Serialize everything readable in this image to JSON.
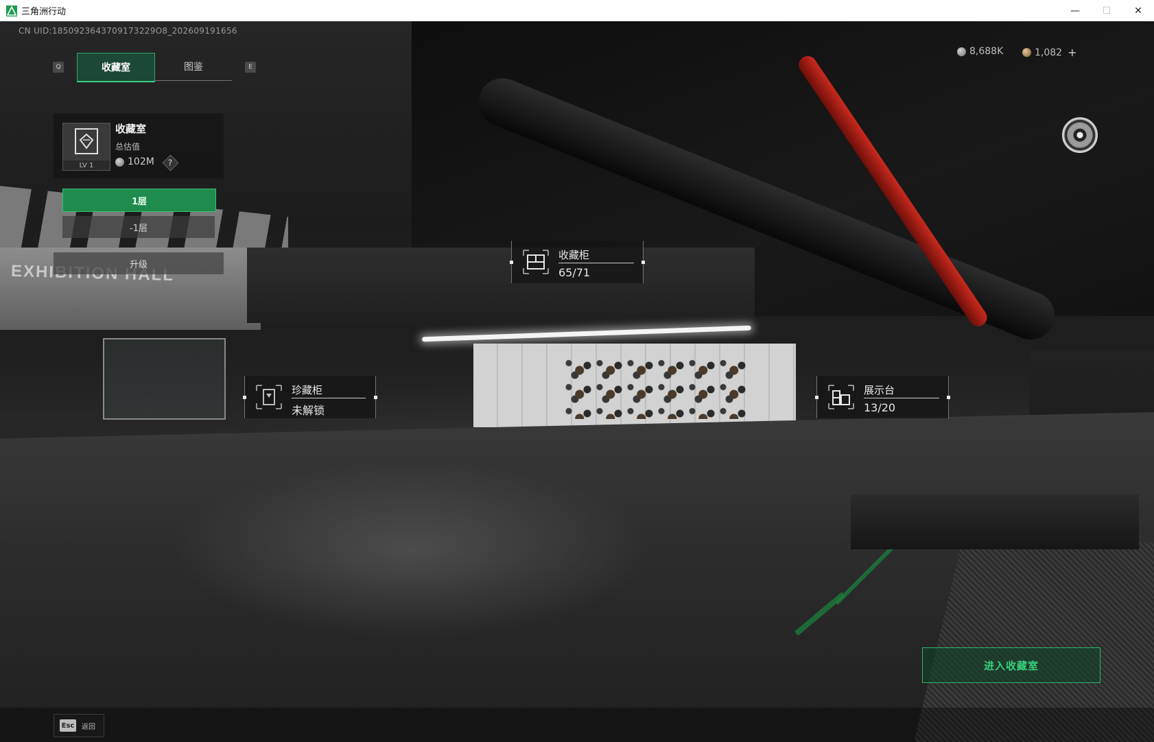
{
  "window": {
    "title": "三角洲行动",
    "minimize_glyph": "—",
    "maximize_glyph": "☐",
    "close_glyph": "✕"
  },
  "uid_text": "CN UID:1850923643709173229O8_202609191656",
  "tabs": {
    "prev_key": "Q",
    "next_key": "E",
    "items": [
      {
        "label": "收藏室",
        "active": true
      },
      {
        "label": "图鉴",
        "active": false
      }
    ]
  },
  "room_panel": {
    "title": "收藏室",
    "level": "LV 1",
    "value_label": "总估值",
    "value": "102M",
    "help": "?",
    "floors": [
      {
        "label": "1层",
        "active": true
      },
      {
        "label": "-1层",
        "active": false
      }
    ],
    "upgrade_label": "升级"
  },
  "currency": {
    "silver": "8,688K",
    "gold": "1,082",
    "plus": "+"
  },
  "scene_text": {
    "exhibition_hall": "EXHIBITION HALL"
  },
  "poi": {
    "cabinet": {
      "title": "收藏柜",
      "value": "65/71"
    },
    "rare_cabinet": {
      "title": "珍藏柜",
      "value": "未解锁"
    },
    "showcase": {
      "title": "展示台",
      "value": "13/20"
    }
  },
  "enter_button": "进入收藏室",
  "back": {
    "key": "Esc",
    "label": "返回"
  },
  "colors": {
    "accent_green": "#37d07b",
    "active_tab_bg": "#1a543c",
    "red_pipe": "#c92a1e"
  }
}
